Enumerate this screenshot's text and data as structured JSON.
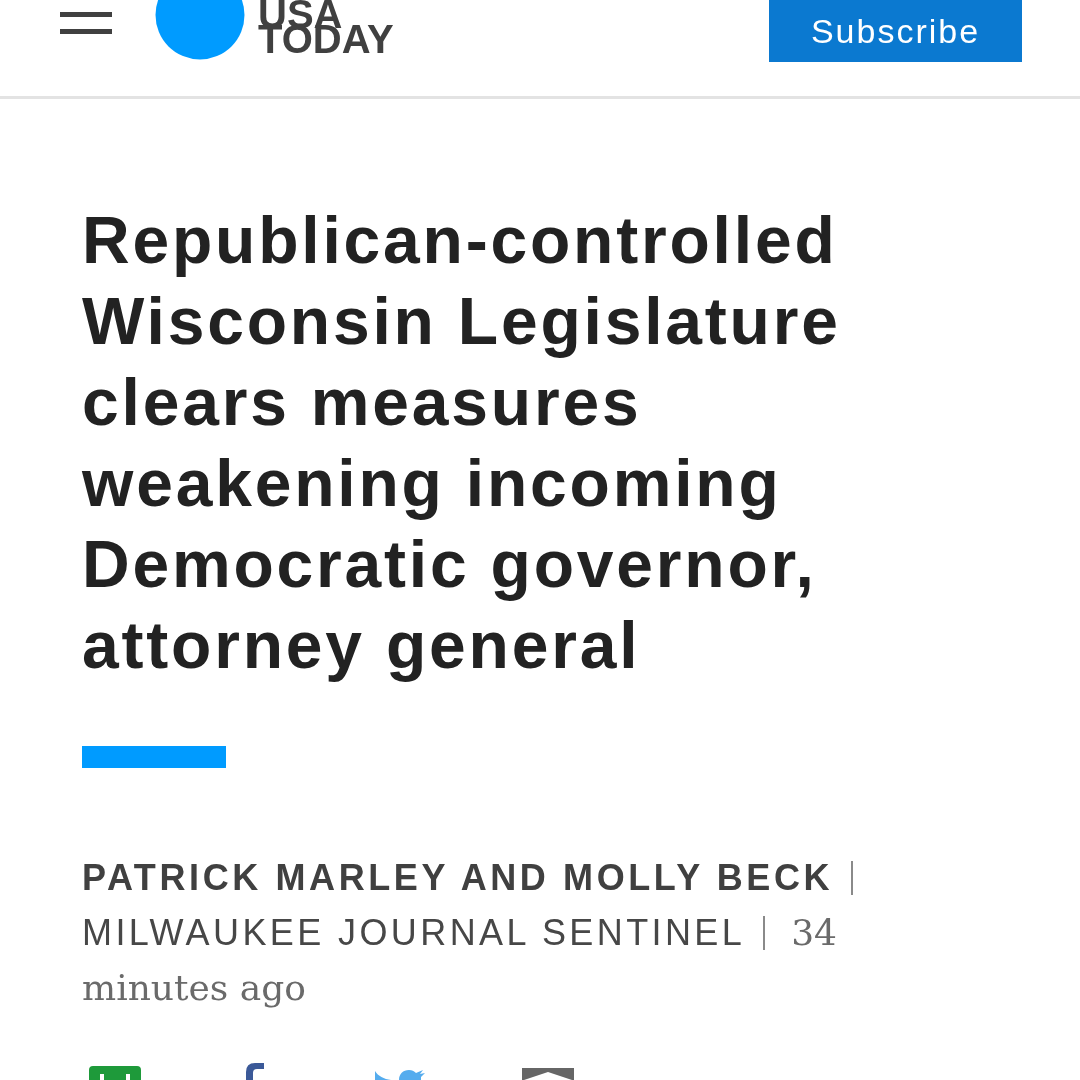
{
  "header": {
    "logo": {
      "wordmark": "USA TODAY"
    },
    "subscribe_button": {
      "label": "Subscribe"
    }
  },
  "article": {
    "headline": "Republican-controlled Wisconsin Legislature clears measures weakening incoming Democratic governor, attorney general",
    "byline": {
      "authors": "PATRICK MARLEY AND MOLLY BECK",
      "source": "MILWAUKEE JOURNAL SENTINEL",
      "published": "34 minutes ago"
    }
  }
}
